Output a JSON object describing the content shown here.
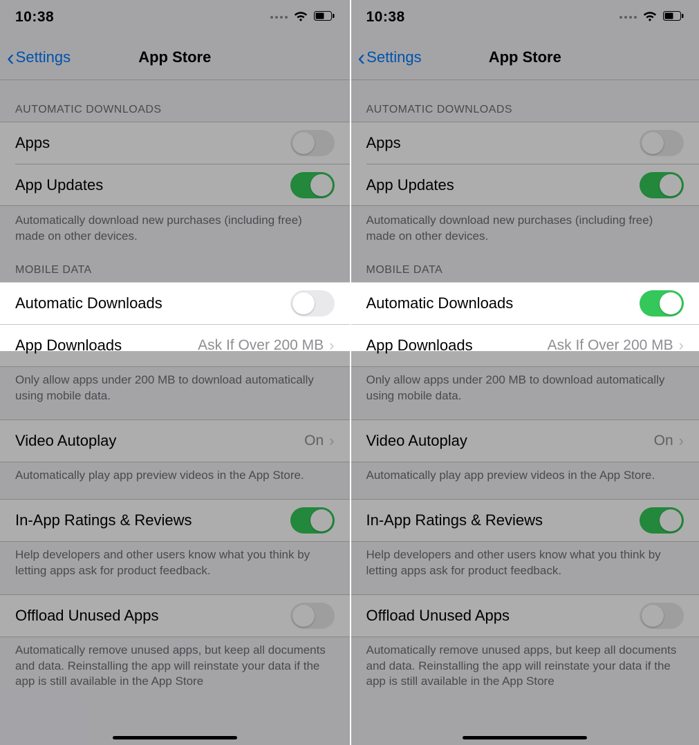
{
  "panes": [
    {
      "statusbar_time": "10:38",
      "nav_back_label": "Settings",
      "nav_title": "App Store",
      "section_auto_downloads_header": "AUTOMATIC DOWNLOADS",
      "row_apps_label": "Apps",
      "row_apps_on": false,
      "row_app_updates_label": "App Updates",
      "row_app_updates_on": true,
      "footer_auto_downloads": "Automatically download new purchases (including free) made on other devices.",
      "section_mobile_data_header": "MOBILE DATA",
      "row_auto_dl_label": "Automatic Downloads",
      "row_auto_dl_on": false,
      "row_app_downloads_label": "App Downloads",
      "row_app_downloads_value": "Ask If Over 200 MB",
      "footer_app_downloads": "Only allow apps under 200 MB to download automatically using mobile data.",
      "row_video_autoplay_label": "Video Autoplay",
      "row_video_autoplay_value": "On",
      "footer_video_autoplay": "Automatically play app preview videos in the App Store.",
      "row_in_app_ratings_label": "In-App Ratings & Reviews",
      "row_in_app_ratings_on": true,
      "footer_in_app_ratings": "Help developers and other users know what you think by letting apps ask for product feedback.",
      "row_offload_label": "Offload Unused Apps",
      "row_offload_on": false,
      "footer_offload": "Automatically remove unused apps, but keep all documents and data. Reinstalling the app will reinstate your data if the app is still available in the App Store"
    },
    {
      "statusbar_time": "10:38",
      "nav_back_label": "Settings",
      "nav_title": "App Store",
      "section_auto_downloads_header": "AUTOMATIC DOWNLOADS",
      "row_apps_label": "Apps",
      "row_apps_on": false,
      "row_app_updates_label": "App Updates",
      "row_app_updates_on": true,
      "footer_auto_downloads": "Automatically download new purchases (including free) made on other devices.",
      "section_mobile_data_header": "MOBILE DATA",
      "row_auto_dl_label": "Automatic Downloads",
      "row_auto_dl_on": true,
      "row_app_downloads_label": "App Downloads",
      "row_app_downloads_value": "Ask If Over 200 MB",
      "footer_app_downloads": "Only allow apps under 200 MB to download automatically using mobile data.",
      "row_video_autoplay_label": "Video Autoplay",
      "row_video_autoplay_value": "On",
      "footer_video_autoplay": "Automatically play app preview videos in the App Store.",
      "row_in_app_ratings_label": "In-App Ratings & Reviews",
      "row_in_app_ratings_on": true,
      "footer_in_app_ratings": "Help developers and other users know what you think by letting apps ask for product feedback.",
      "row_offload_label": "Offload Unused Apps",
      "row_offload_on": false,
      "footer_offload": "Automatically remove unused apps, but keep all documents and data. Reinstalling the app will reinstate your data if the app is still available in the App Store"
    }
  ]
}
